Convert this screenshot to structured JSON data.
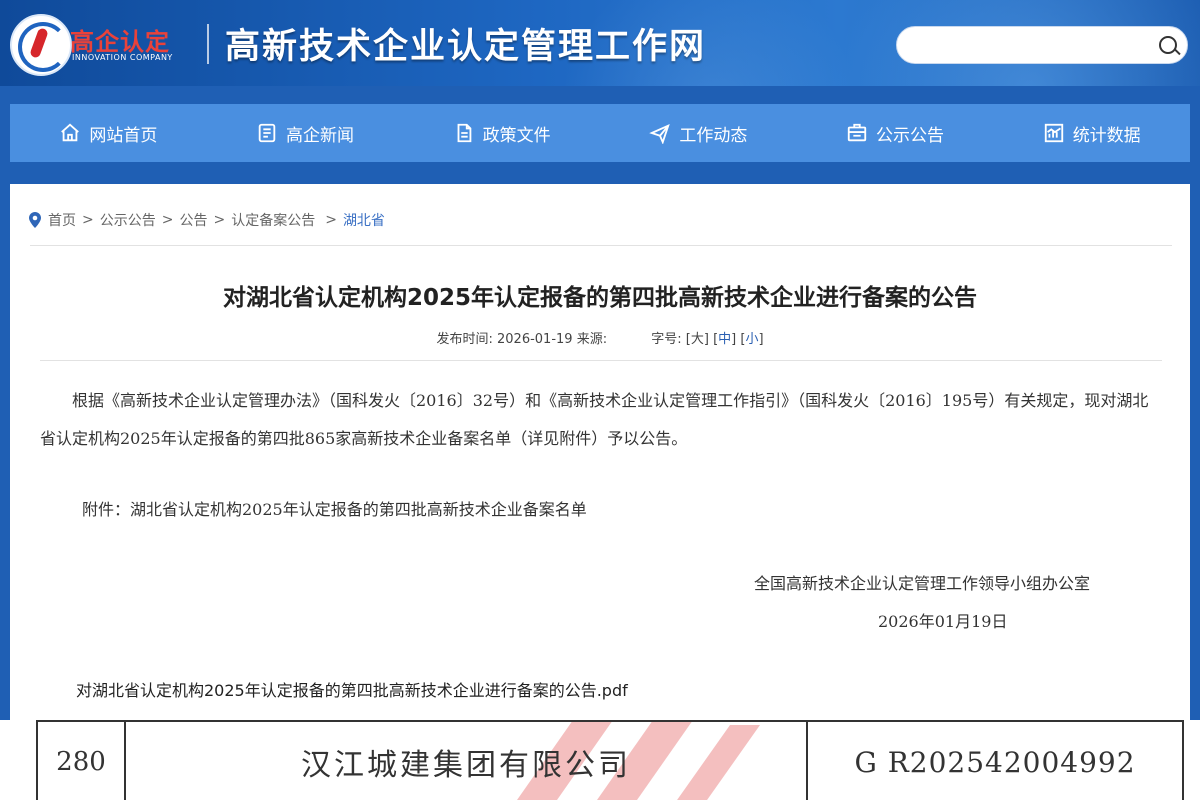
{
  "header": {
    "logo_cn": "高企认定",
    "logo_en": "INNOVATION COMPANY",
    "site_title": "高新技术企业认定管理工作网",
    "search_placeholder": ""
  },
  "nav": {
    "items": [
      {
        "label": "网站首页",
        "icon": "home-icon"
      },
      {
        "label": "高企新闻",
        "icon": "news-icon"
      },
      {
        "label": "政策文件",
        "icon": "document-icon"
      },
      {
        "label": "工作动态",
        "icon": "paper-plane-icon"
      },
      {
        "label": "公示公告",
        "icon": "notice-icon"
      },
      {
        "label": "统计数据",
        "icon": "chart-icon"
      }
    ]
  },
  "breadcrumb": {
    "items": [
      "首页",
      "公示公告",
      "公告",
      "认定备案公告"
    ],
    "current": "湖北省",
    "separator": ">"
  },
  "article": {
    "title": "对湖北省认定机构2025年认定报备的第四批高新技术企业进行备案的公告",
    "publish_label": "发布时间:",
    "publish_date": "2026-01-19",
    "source_label": "来源:",
    "font_size_label": "字号:",
    "size_large": "大",
    "size_medium": "中",
    "size_small": "小",
    "paragraph": "根据《高新技术企业认定管理办法》（国科发火〔2016〕32号）和《高新技术企业认定管理工作指引》（国科发火〔2016〕195号）有关规定，现对湖北省认定机构2025年认定报备的第四批865家高新技术企业备案名单（详见附件）予以公告。",
    "attachment": "附件：湖北省认定机构2025年认定报备的第四批高新技术企业备案名单",
    "sign_org": "全国高新技术企业认定管理工作领导小组办公室",
    "sign_date": "2026年01月19日",
    "pdf_link": "对湖北省认定机构2025年认定报备的第四批高新技术企业进行备案的公告.pdf"
  },
  "pdf_preview": {
    "row": {
      "no": "280",
      "name": "汉江城建集团有限公司",
      "code": "G R202542004992"
    }
  },
  "colors": {
    "header_bg": "#1e67c2",
    "nav_bg": "#4a8fe0",
    "logo_red": "#e9423a",
    "link_blue": "#3a70c4"
  }
}
